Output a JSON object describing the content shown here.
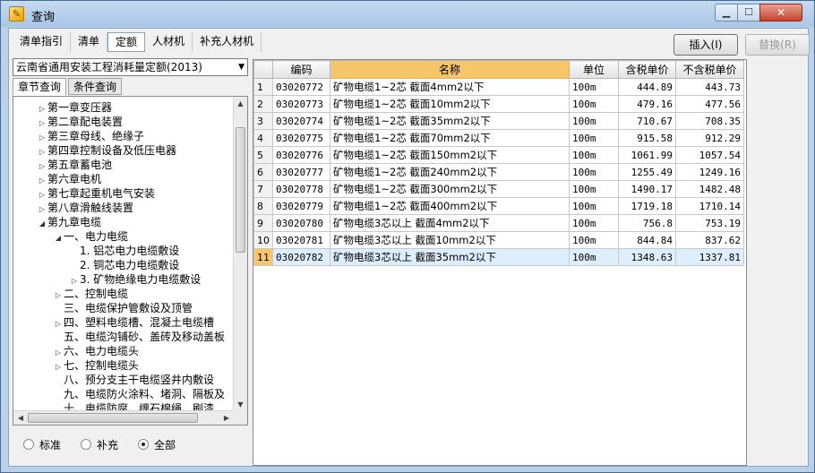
{
  "window": {
    "title": "查询",
    "min_label": "▁",
    "max_label": "☐",
    "close_label": "✕"
  },
  "tabs": [
    "清单指引",
    "清单",
    "定额",
    "人材机",
    "补充人材机"
  ],
  "toolbar": {
    "insert_label": "插入(I)",
    "replace_label": "替换(R)"
  },
  "left": {
    "combo_value": "云南省通用安装工程消耗量定额(2013)",
    "subtabs": [
      "章节查询",
      "条件查询"
    ],
    "tree": [
      {
        "label": "第一章变压器",
        "level": 0,
        "state": "collapsed"
      },
      {
        "label": "第二章配电装置",
        "level": 0,
        "state": "collapsed"
      },
      {
        "label": "第三章母线、绝缘子",
        "level": 0,
        "state": "collapsed"
      },
      {
        "label": "第四章控制设备及低压电器",
        "level": 0,
        "state": "collapsed"
      },
      {
        "label": "第五章蓄电池",
        "level": 0,
        "state": "collapsed"
      },
      {
        "label": "第六章电机",
        "level": 0,
        "state": "collapsed"
      },
      {
        "label": "第七章起重机电气安装",
        "level": 0,
        "state": "collapsed"
      },
      {
        "label": "第八章滑触线装置",
        "level": 0,
        "state": "collapsed"
      },
      {
        "label": "第九章电缆",
        "level": 0,
        "state": "expanded"
      },
      {
        "label": "一、电力电缆",
        "level": 1,
        "state": "expanded"
      },
      {
        "label": "1. 铝芯电力电缆敷设",
        "level": 2,
        "state": "leaf"
      },
      {
        "label": "2. 铜芯电力电缆敷设",
        "level": 2,
        "state": "leaf"
      },
      {
        "label": "3. 矿物绝缘电力电缆敷设",
        "level": 2,
        "state": "collapsed"
      },
      {
        "label": "二、控制电缆",
        "level": 1,
        "state": "collapsed"
      },
      {
        "label": "三、电缆保护管敷设及顶管",
        "level": 1,
        "state": "leaf"
      },
      {
        "label": "四、塑料电缆槽、混凝土电缆槽",
        "level": 1,
        "state": "collapsed"
      },
      {
        "label": "五、电缆沟铺砂、盖砖及移动盖板",
        "level": 1,
        "state": "leaf"
      },
      {
        "label": "六、电力电缆头",
        "level": 1,
        "state": "collapsed"
      },
      {
        "label": "七、控制电缆头",
        "level": 1,
        "state": "collapsed"
      },
      {
        "label": "八、预分支主干电缆竖井内敷设",
        "level": 1,
        "state": "leaf"
      },
      {
        "label": "九、电缆防火涂料、堵洞、隔板及",
        "level": 1,
        "state": "leaf"
      },
      {
        "label": "十、电缆防腐、缠石棉绳、刷漆",
        "level": 1,
        "state": "leaf"
      }
    ],
    "radios": [
      {
        "label": "标准",
        "checked": false
      },
      {
        "label": "补充",
        "checked": false
      },
      {
        "label": "全部",
        "checked": true
      }
    ]
  },
  "table": {
    "columns": [
      "",
      "编码",
      "名称",
      "单位",
      "含税单价",
      "不含税单价"
    ],
    "rows": [
      [
        "1",
        "03020772",
        "矿物电缆1~2芯 截面4mm2以下",
        "100m",
        "444.89",
        "443.73"
      ],
      [
        "2",
        "03020773",
        "矿物电缆1~2芯 截面10mm2以下",
        "100m",
        "479.16",
        "477.56"
      ],
      [
        "3",
        "03020774",
        "矿物电缆1~2芯 截面35mm2以下",
        "100m",
        "710.67",
        "708.35"
      ],
      [
        "4",
        "03020775",
        "矿物电缆1~2芯 截面70mm2以下",
        "100m",
        "915.58",
        "912.29"
      ],
      [
        "5",
        "03020776",
        "矿物电缆1~2芯 截面150mm2以下",
        "100m",
        "1061.99",
        "1057.54"
      ],
      [
        "6",
        "03020777",
        "矿物电缆1~2芯 截面240mm2以下",
        "100m",
        "1255.49",
        "1249.16"
      ],
      [
        "7",
        "03020778",
        "矿物电缆1~2芯 截面300mm2以下",
        "100m",
        "1490.17",
        "1482.48"
      ],
      [
        "8",
        "03020779",
        "矿物电缆1~2芯 截面400mm2以下",
        "100m",
        "1719.18",
        "1710.14"
      ],
      [
        "9",
        "03020780",
        "矿物电缆3芯以上 截面4mm2以下",
        "100m",
        "756.8",
        "753.19"
      ],
      [
        "10",
        "03020781",
        "矿物电缆3芯以上 截面10mm2以下",
        "100m",
        "844.84",
        "837.62"
      ],
      [
        "11",
        "03020782",
        "矿物电缆3芯以上 截面35mm2以下",
        "100m",
        "1348.63",
        "1337.81"
      ]
    ],
    "selected_row": 11
  },
  "colors": {
    "accent_header": "#f7c66a",
    "selected_row": "#ddefff",
    "titlebar": "#b9d1ea"
  }
}
